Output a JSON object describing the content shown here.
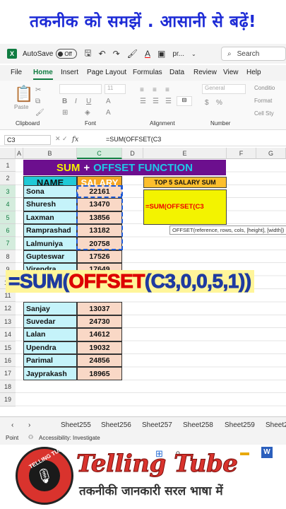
{
  "banner": {
    "text": "तकनीक को समझें . आसानी से बढ़ें!"
  },
  "titlebar": {
    "app_icon": "excel-icon",
    "autosave": "AutoSave",
    "toggle": "Off",
    "filename": "pr...",
    "search": "Search"
  },
  "menu": [
    "File",
    "Home",
    "Insert",
    "Page Layout",
    "Formulas",
    "Data",
    "Review",
    "View",
    "Help"
  ],
  "ribbon": {
    "groups": [
      "Clipboard",
      "Font",
      "Alignment",
      "Number"
    ],
    "paste_label": "Paste",
    "font_size": "11",
    "number_format": "General",
    "styles": [
      "Conditio",
      "Format",
      "Cell Sty"
    ]
  },
  "formula_bar": {
    "name_box": "C3",
    "fx": "fx",
    "formula": "=SUM(OFFSET(C3"
  },
  "columns": [
    "A",
    "B",
    "C",
    "D",
    "E",
    "F",
    "G"
  ],
  "rows": [
    "1",
    "2",
    "3",
    "4",
    "5",
    "6",
    "7",
    "8",
    "9",
    "10",
    "11",
    "12",
    "13",
    "14",
    "15",
    "16",
    "17",
    "18",
    "19"
  ],
  "sheet": {
    "title_parts": [
      "SUM",
      "+",
      "OFFSET FUNCTION"
    ],
    "headers": {
      "name": "NAME",
      "salary": "SALARY"
    },
    "data": [
      {
        "name": "Sona",
        "salary": "22161"
      },
      {
        "name": "Shuresh",
        "salary": "13470"
      },
      {
        "name": "Laxman",
        "salary": "13856"
      },
      {
        "name": "Ramprashad",
        "salary": "13182"
      },
      {
        "name": "Lalmuniya",
        "salary": "20758"
      },
      {
        "name": "Gupteswar",
        "salary": "17526"
      },
      {
        "name": "Virendra",
        "salary": "17649"
      },
      {
        "name": "",
        "salary": ""
      },
      {
        "name": "",
        "salary": ""
      },
      {
        "name": "Sanjay",
        "salary": "13037"
      },
      {
        "name": "Suvedar",
        "salary": "24730"
      },
      {
        "name": "Lalan",
        "salary": "14612"
      },
      {
        "name": "Upendra",
        "salary": "19032"
      },
      {
        "name": "Parimal",
        "salary": "24856"
      },
      {
        "name": "Jayprakash",
        "salary": "18965"
      }
    ],
    "top5_label": "TOP 5 SALARY SUM",
    "formula_cell": "=SUM(OFFSET(C3",
    "tooltip": "OFFSET(reference, rows, cols, [height], [width])"
  },
  "big_formula": {
    "part1": "=SUM(",
    "part2": "OFFSET",
    "part3": "(C3,0,0,5,1))"
  },
  "sheet_tabs": [
    "Sheet255",
    "Sheet256",
    "Sheet257",
    "Sheet258",
    "Sheet259",
    "Sheet2"
  ],
  "status": {
    "mode": "Point",
    "accessibility": "Accessibility: Investigate"
  },
  "brand": {
    "name": "Telling Tube",
    "tagline": "तकनीकी जानकारी सरल भाषा में",
    "logo_text": "TELLING TUBE"
  },
  "colors": {
    "title_bg": "#6c0f8e",
    "name_hdr": "#20c9d6",
    "salary_hdr": "#f5a623",
    "name_col": "#c5f3fa",
    "salary_col": "#f9d8c6",
    "excel_green": "#107c41"
  }
}
